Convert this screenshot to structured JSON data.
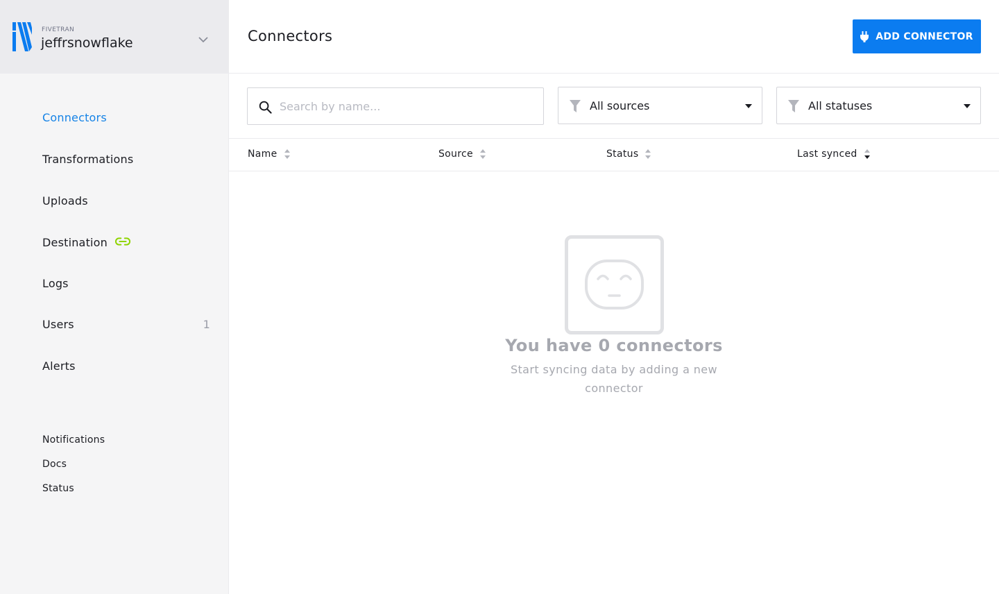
{
  "account": {
    "brand": "FIVETRAN",
    "name": "jeffrsnowflake"
  },
  "nav": {
    "items": [
      {
        "label": "Connectors",
        "active": true
      },
      {
        "label": "Transformations"
      },
      {
        "label": "Uploads"
      },
      {
        "label": "Destination"
      },
      {
        "label": "Logs"
      },
      {
        "label": "Users",
        "count": "1"
      },
      {
        "label": "Alerts"
      }
    ],
    "secondary": [
      {
        "label": "Notifications"
      },
      {
        "label": "Docs"
      },
      {
        "label": "Status"
      }
    ]
  },
  "header": {
    "title": "Connectors",
    "add_button": "ADD CONNECTOR"
  },
  "filters": {
    "search_placeholder": "Search by name...",
    "source_select": "All sources",
    "status_select": "All statuses"
  },
  "table": {
    "columns": [
      "Name",
      "Source",
      "Status",
      "Last synced"
    ]
  },
  "empty": {
    "title": "You have 0 connectors",
    "subtitle": "Start syncing data by adding a new connector"
  },
  "colors": {
    "accent": "#0b7cf0",
    "active_nav": "#1683e6",
    "destination_link": "#8fd400"
  }
}
